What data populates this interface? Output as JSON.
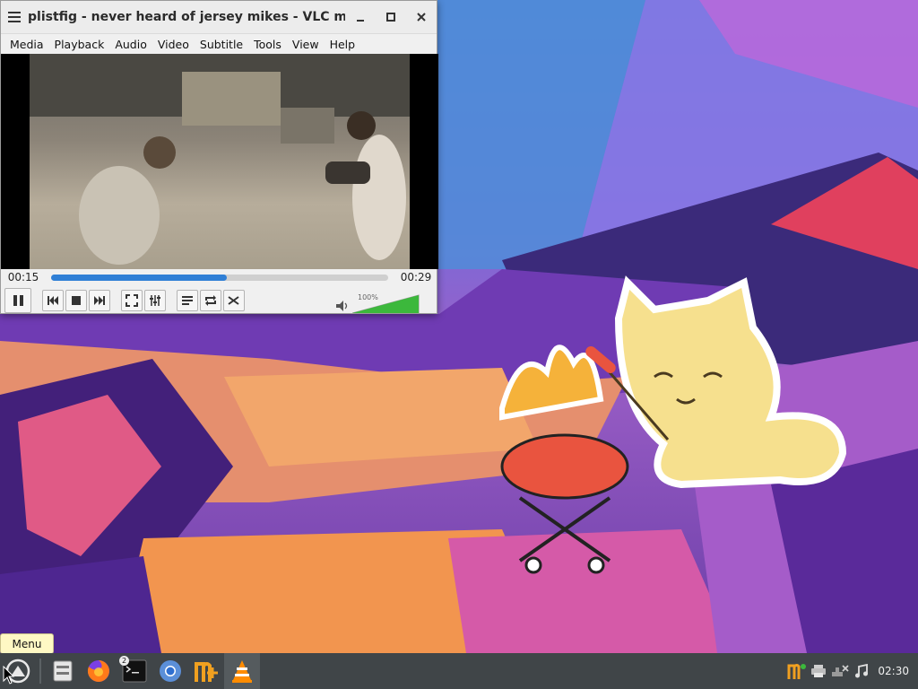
{
  "window": {
    "title": "plistfig - never heard of jersey mikes - VLC media pla...",
    "minimize_icon": "minimize-icon",
    "maximize_icon": "maximize-icon",
    "close_icon": "close-icon"
  },
  "menubar": {
    "items": [
      "Media",
      "Playback",
      "Audio",
      "Video",
      "Subtitle",
      "Tools",
      "View",
      "Help"
    ]
  },
  "playback": {
    "elapsed": "00:15",
    "total": "00:29",
    "progress_fraction": 0.52,
    "volume_label": "100%",
    "volume_fraction": 1.0
  },
  "controls": {
    "play_state": "paused",
    "icons": [
      "pause-icon",
      "previous-icon",
      "stop-icon",
      "next-icon",
      "fullscreen-icon",
      "extended-settings-icon",
      "playlist-icon",
      "loop-icon",
      "shuffle-icon",
      "volume-icon"
    ]
  },
  "taskbar": {
    "menu_tooltip": "Menu",
    "terminal_badge": "2",
    "clock": "02:30",
    "apps": [
      "start-menu-icon",
      "file-manager-icon",
      "firefox-icon",
      "terminal-icon",
      "chromium-icon",
      "notepadqq-icon",
      "vlc-icon"
    ],
    "tray": [
      "notepadqq-tray-icon",
      "printer-icon",
      "network-disconnected-icon",
      "audio-icon"
    ]
  },
  "colors": {
    "seek_fill": "#2f7fd6",
    "volume_fill": "#3cb83c",
    "taskbar_bg": "#404548",
    "tooltip_bg": "#fff8c4"
  }
}
